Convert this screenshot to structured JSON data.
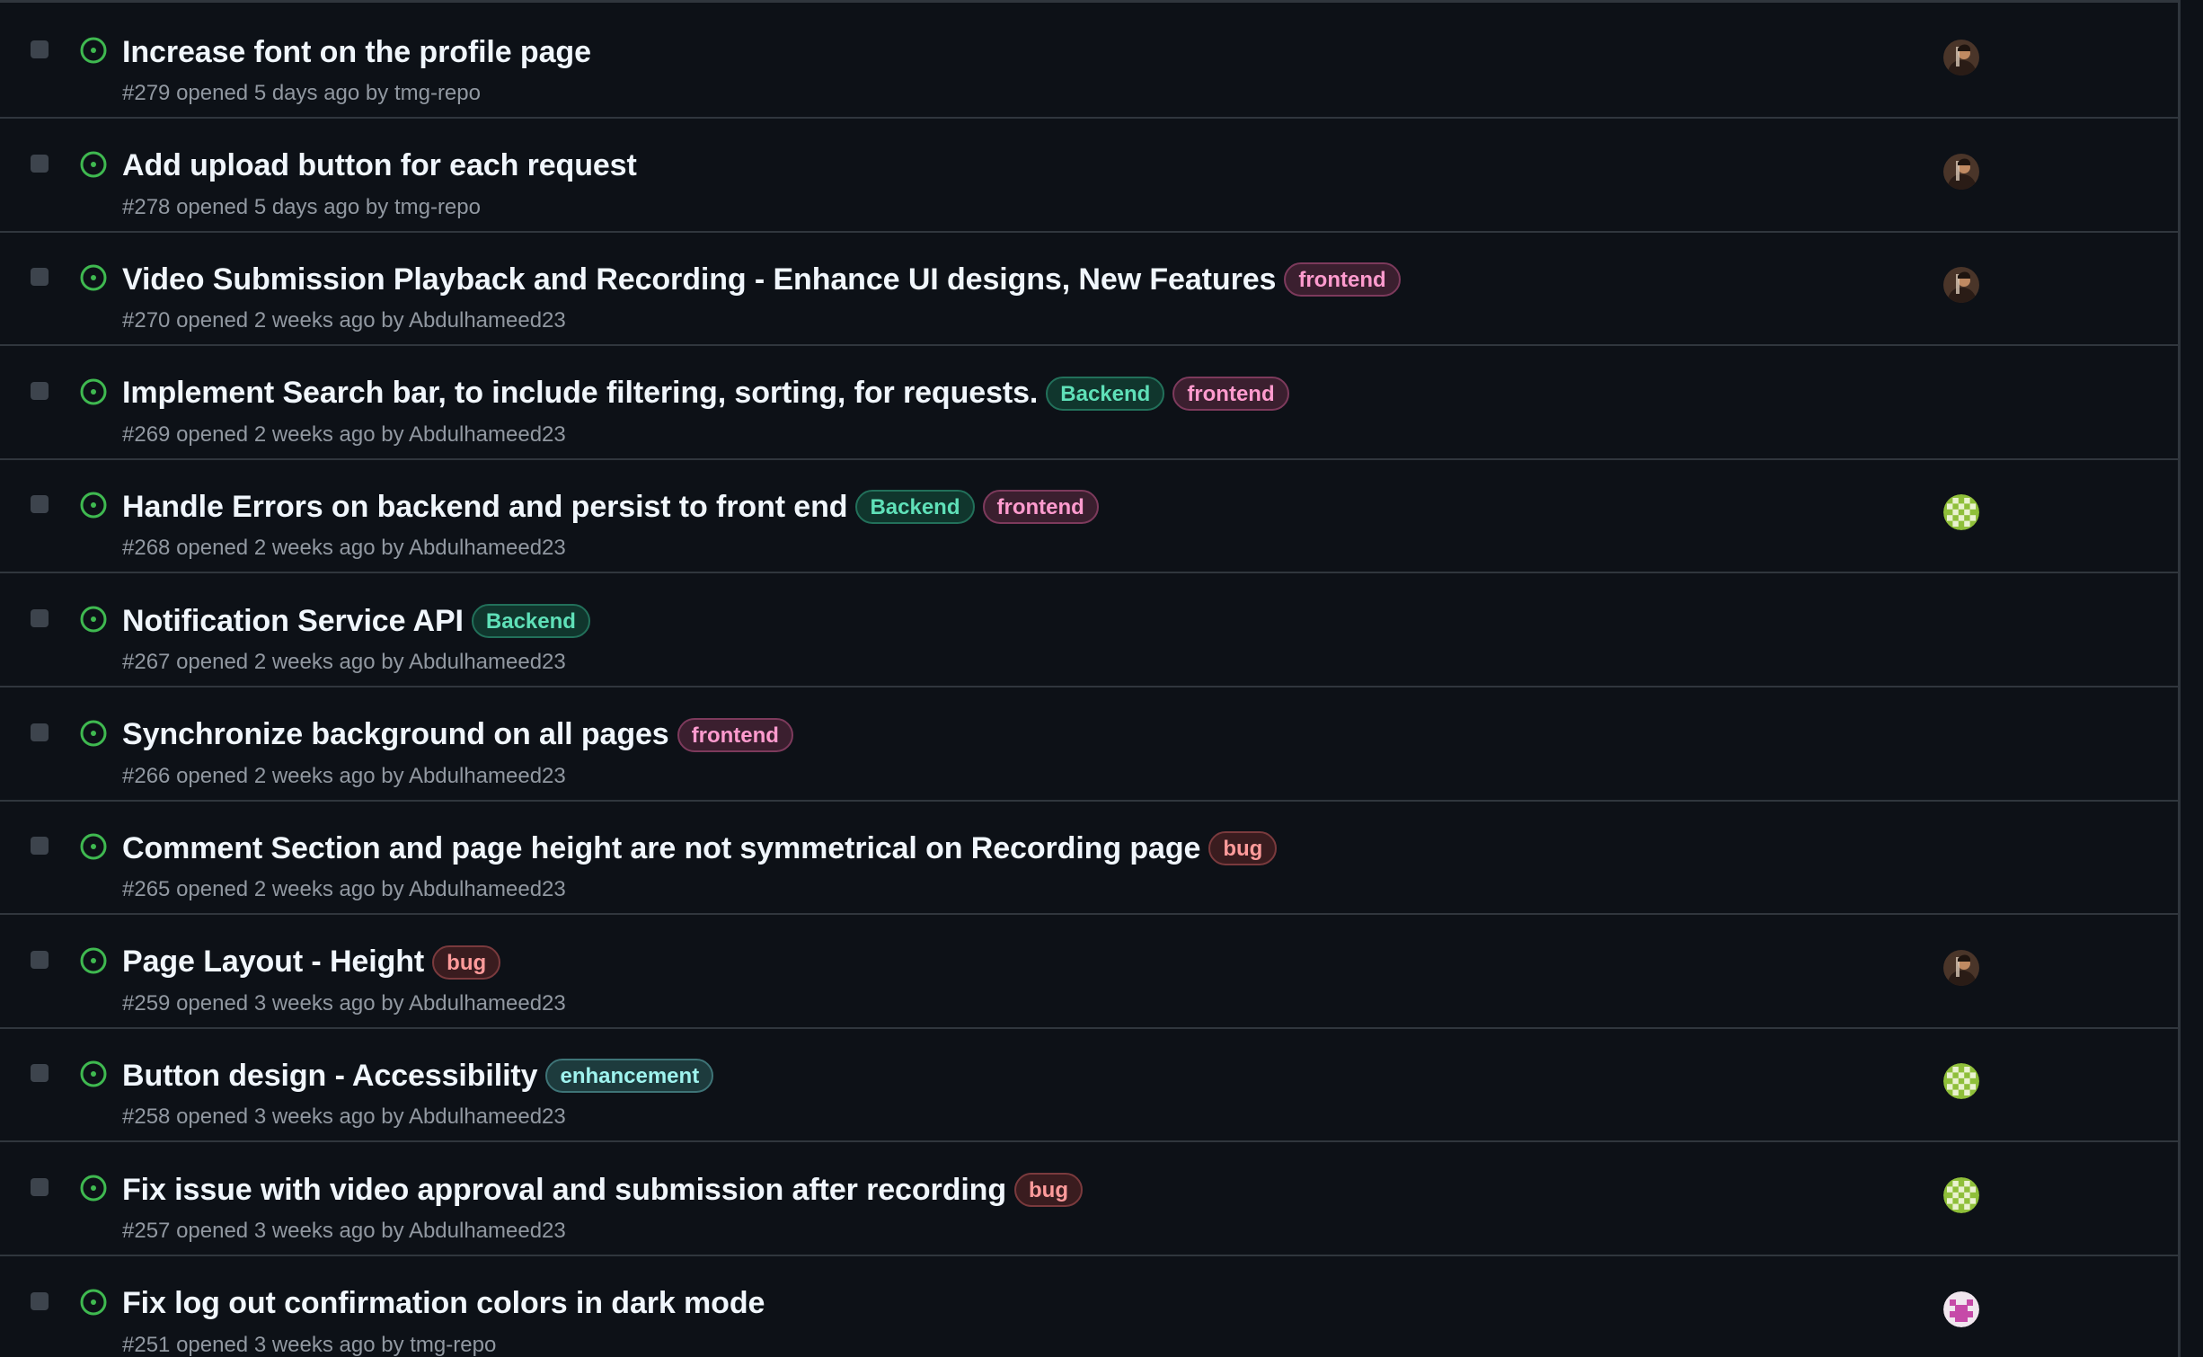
{
  "label_styles": {
    "frontend": {
      "text": "#ff9bce",
      "bg": "#3b1f2f",
      "border": "#7d3a5c"
    },
    "Backend": {
      "text": "#5fe0b8",
      "bg": "#10362d",
      "border": "#22705a"
    },
    "bug": {
      "text": "#ff9b9b",
      "bg": "#3a1c1f",
      "border": "#7a3a3d"
    },
    "enhancement": {
      "text": "#9ff3ee",
      "bg": "#1d3b3d",
      "border": "#3e7477"
    }
  },
  "status_color": "#3fb950",
  "issues": [
    {
      "title": "Increase font on the profile page",
      "labels": [],
      "number": "#279",
      "opened": "opened 5 days ago by",
      "author": "tmg-repo",
      "avatar": "photo"
    },
    {
      "title": "Add upload button for each request",
      "labels": [],
      "number": "#278",
      "opened": "opened 5 days ago by",
      "author": "tmg-repo",
      "avatar": "photo"
    },
    {
      "title": "Video Submission Playback and Recording - Enhance UI designs, New Features",
      "labels": [
        "frontend"
      ],
      "number": "#270",
      "opened": "opened 2 weeks ago by",
      "author": "Abdulhameed23",
      "avatar": "photo"
    },
    {
      "title": "Implement Search bar, to include filtering, sorting, for requests.",
      "labels": [
        "Backend",
        "frontend"
      ],
      "number": "#269",
      "opened": "opened 2 weeks ago by",
      "author": "Abdulhameed23",
      "avatar": null
    },
    {
      "title": "Handle Errors on backend and persist to front end",
      "labels": [
        "Backend",
        "frontend"
      ],
      "number": "#268",
      "opened": "opened 2 weeks ago by",
      "author": "Abdulhameed23",
      "avatar": "identicon-green"
    },
    {
      "title": "Notification Service API",
      "labels": [
        "Backend"
      ],
      "number": "#267",
      "opened": "opened 2 weeks ago by",
      "author": "Abdulhameed23",
      "avatar": null
    },
    {
      "title": "Synchronize background on all pages",
      "labels": [
        "frontend"
      ],
      "number": "#266",
      "opened": "opened 2 weeks ago by",
      "author": "Abdulhameed23",
      "avatar": null
    },
    {
      "title": "Comment Section and page height are not symmetrical on Recording page",
      "labels": [
        "bug"
      ],
      "number": "#265",
      "opened": "opened 2 weeks ago by",
      "author": "Abdulhameed23",
      "avatar": null
    },
    {
      "title": "Page Layout - Height",
      "labels": [
        "bug"
      ],
      "number": "#259",
      "opened": "opened 3 weeks ago by",
      "author": "Abdulhameed23",
      "avatar": "photo"
    },
    {
      "title": "Button design - Accessibility",
      "labels": [
        "enhancement"
      ],
      "number": "#258",
      "opened": "opened 3 weeks ago by",
      "author": "Abdulhameed23",
      "avatar": "identicon-green"
    },
    {
      "title": "Fix issue with video approval and submission after recording",
      "labels": [
        "bug"
      ],
      "number": "#257",
      "opened": "opened 3 weeks ago by",
      "author": "Abdulhameed23",
      "avatar": "identicon-green"
    },
    {
      "title": "Fix log out confirmation colors in dark mode",
      "labels": [],
      "number": "#251",
      "opened": "opened 3 weeks ago by",
      "author": "tmg-repo",
      "avatar": "identicon-pink"
    }
  ]
}
